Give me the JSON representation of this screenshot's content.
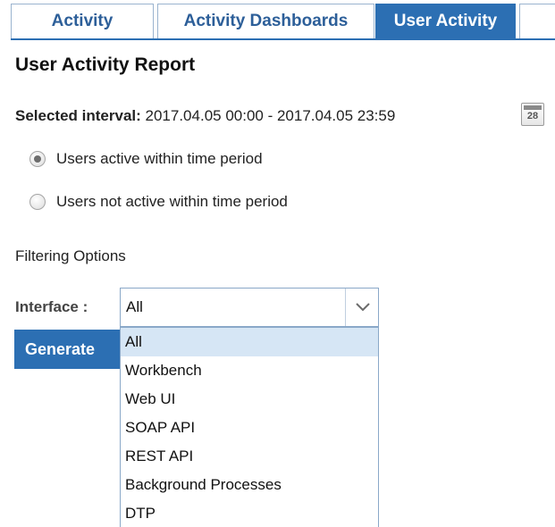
{
  "tabs": [
    {
      "label": "Activity",
      "active": false
    },
    {
      "label": "Activity Dashboards",
      "active": false
    },
    {
      "label": "User Activity",
      "active": true
    },
    {
      "label": "",
      "active": false
    }
  ],
  "page_title": "User Activity Report",
  "interval": {
    "label": "Selected interval:",
    "value": "2017.04.05 00:00 - 2017.04.05 23:59",
    "calendar_day": "28"
  },
  "radios": [
    {
      "label": "Users active within time period",
      "checked": true
    },
    {
      "label": "Users not active within time period",
      "checked": false
    }
  ],
  "filtering": {
    "heading": "Filtering Options",
    "interface_label": "Interface :",
    "interface_value": "All",
    "options": [
      "All",
      "Workbench",
      "Web UI",
      "SOAP API",
      "REST API",
      "Background Processes",
      "DTP"
    ],
    "selected_option": "All"
  },
  "generate_label": "Generate",
  "colors": {
    "accent": "#2c6fb3",
    "tab_text": "#2d5f99",
    "selected_option_bg": "#d6e6f5"
  }
}
